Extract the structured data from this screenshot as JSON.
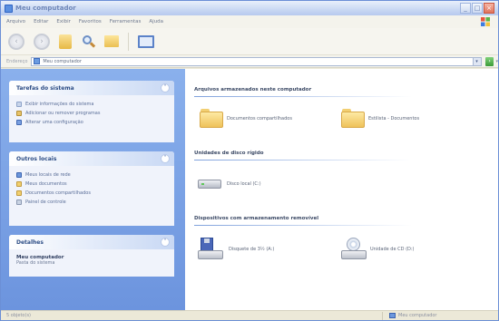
{
  "window": {
    "title": "Meu computador"
  },
  "menu": [
    "Arquivo",
    "Editar",
    "Exibir",
    "Favoritos",
    "Ferramentas",
    "Ajuda"
  ],
  "toolbar": {
    "back_icon": "back-arrow-icon",
    "forward_icon": "forward-arrow-icon"
  },
  "address": {
    "label": "Endereço",
    "value": "Meu computador",
    "go": "›"
  },
  "tasks_panel": {
    "title": "Tarefas do sistema",
    "items": [
      "Exibir informações do sistema",
      "Adicionar ou remover programas",
      "Alterar uma configuração"
    ]
  },
  "places_panel": {
    "title": "Outros locais",
    "items": [
      "Meus locais de rede",
      "Meus documentos",
      "Documentos compartilhados",
      "Painel de controle"
    ]
  },
  "details_panel": {
    "title": "Detalhes",
    "name": "Meu computador",
    "subtitle": "Pasta do sistema"
  },
  "content": {
    "group_files": "Arquivos armazenados neste computador",
    "file_items": [
      "Documentos compartilhados",
      "Estilista - Documentos"
    ],
    "group_hdd": "Unidades de disco rígido",
    "hdd_items": [
      "Disco local (C:)"
    ],
    "group_removable": "Dispositivos com armazenamento removível",
    "removable_items": [
      "Disquete de 3½ (A:)",
      "Unidade de CD (D:)"
    ]
  },
  "status": {
    "left": "5 objeto(s)",
    "right": "Meu computador"
  },
  "colors": {
    "task_pane": "#7aa2e6",
    "panel_title": "#2e4e86",
    "accent_line": "#7fa1dc"
  }
}
